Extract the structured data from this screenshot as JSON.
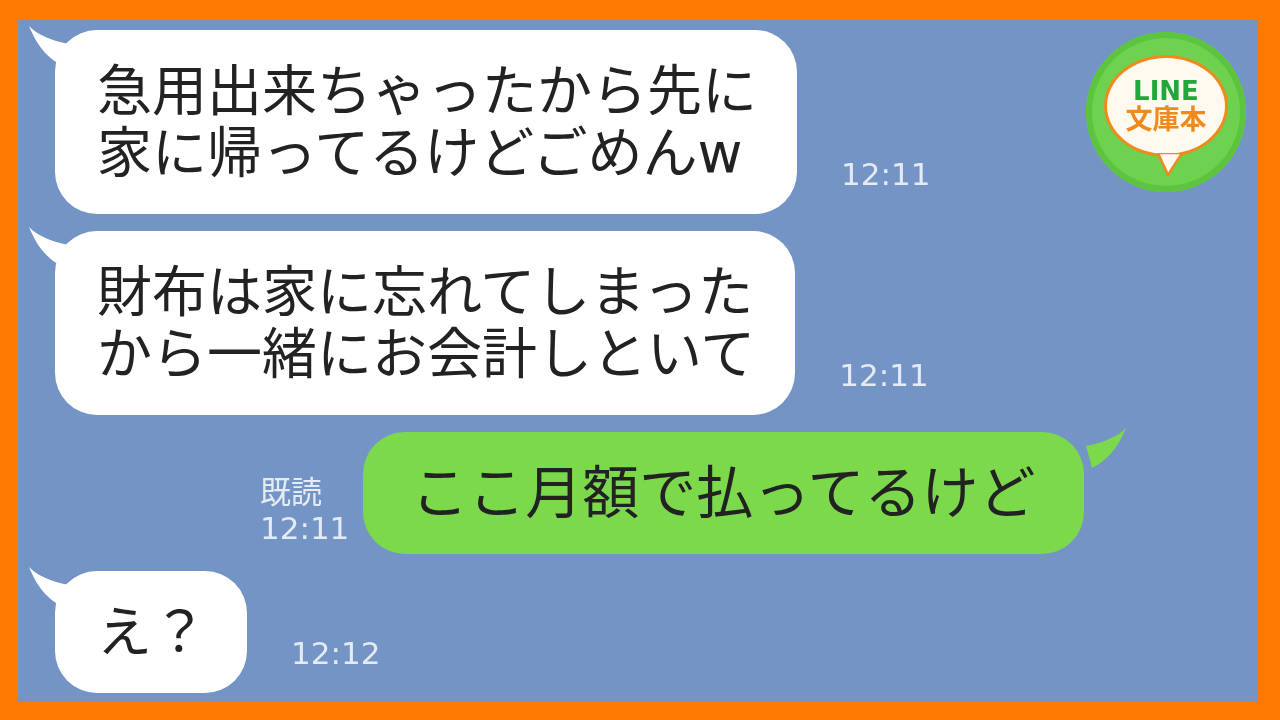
{
  "logo": {
    "line1": "LINE",
    "line2": "文庫本"
  },
  "messages": [
    {
      "kind": "received",
      "lines": [
        "急用出来ちゃったから先に",
        "家に帰ってるけどごめんw"
      ],
      "time": "12:11"
    },
    {
      "kind": "received",
      "lines": [
        "財布は家に忘れてしまった",
        "から一緒にお会計しといて"
      ],
      "time": "12:11"
    },
    {
      "kind": "sent",
      "text": "ここ月額で払ってるけど",
      "read": "既読",
      "time": "12:11"
    },
    {
      "kind": "received",
      "lines": [
        "え？"
      ],
      "time": "12:12"
    }
  ]
}
